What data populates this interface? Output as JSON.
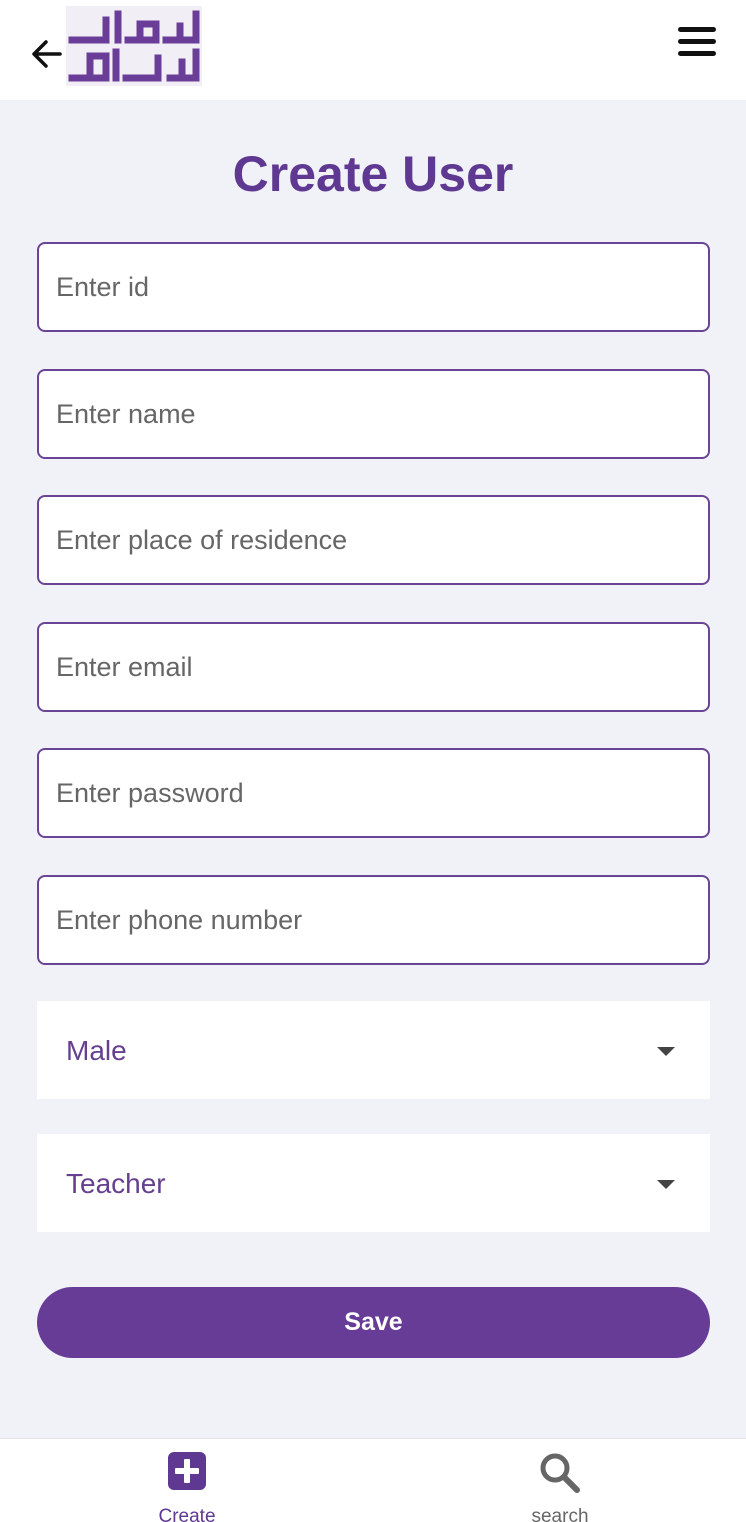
{
  "header": {
    "logo_text": "شطرنج القدس",
    "back_icon": "arrow-left-icon",
    "menu_icon": "hamburger-menu-icon"
  },
  "form": {
    "title": "Create User",
    "fields": [
      {
        "placeholder": "Enter id",
        "value": ""
      },
      {
        "placeholder": "Enter name",
        "value": ""
      },
      {
        "placeholder": "Enter place of residence",
        "value": ""
      },
      {
        "placeholder": "Enter email",
        "value": ""
      },
      {
        "placeholder": "Enter password",
        "value": ""
      },
      {
        "placeholder": "Enter phone number",
        "value": ""
      }
    ],
    "gender_select": {
      "selected": "Male"
    },
    "role_select": {
      "selected": "Teacher"
    },
    "save_label": "Save"
  },
  "bottom_nav": {
    "items": [
      {
        "label": "Create",
        "icon": "plus-square-icon"
      },
      {
        "label": "search",
        "icon": "search-icon"
      }
    ]
  },
  "colors": {
    "accent": "#673c97",
    "background": "#f0f2f8",
    "border": "#6a4595"
  }
}
